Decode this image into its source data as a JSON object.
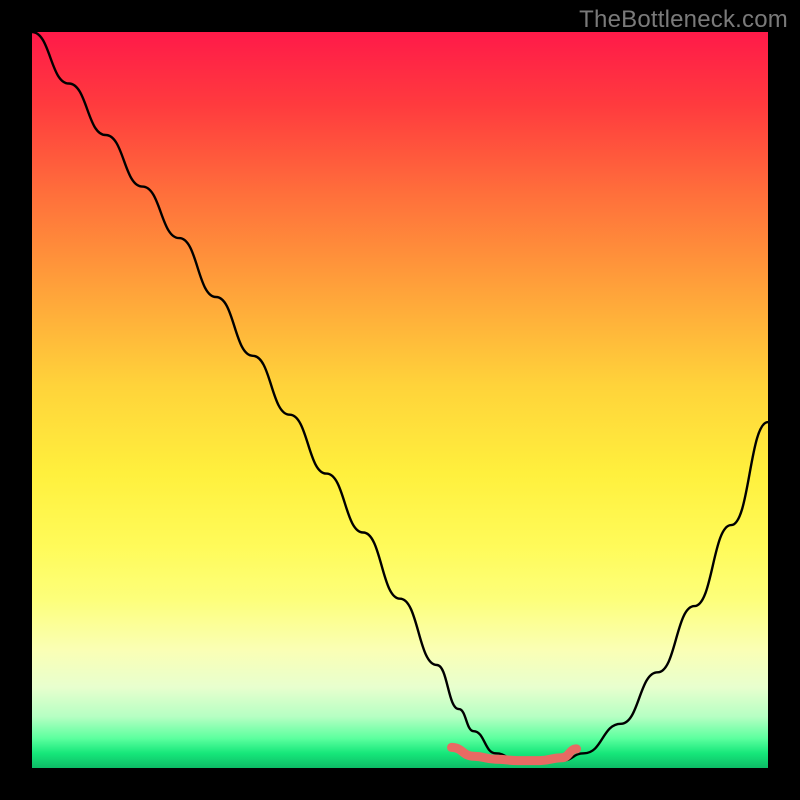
{
  "watermark": "TheBottleneck.com",
  "chart_data": {
    "type": "line",
    "title": "",
    "xlabel": "",
    "ylabel": "",
    "xlim": [
      0,
      100
    ],
    "ylim": [
      0,
      100
    ],
    "grid": false,
    "series": [
      {
        "name": "bottleneck-curve",
        "color": "#000000",
        "x": [
          0,
          5,
          10,
          15,
          20,
          25,
          30,
          35,
          40,
          45,
          50,
          55,
          58,
          60,
          63,
          66,
          69,
          72,
          75,
          80,
          85,
          90,
          95,
          100
        ],
        "y": [
          100,
          93,
          86,
          79,
          72,
          64,
          56,
          48,
          40,
          32,
          23,
          14,
          8,
          5,
          2,
          1,
          1,
          1,
          2,
          6,
          13,
          22,
          33,
          47
        ]
      },
      {
        "name": "optimal-band",
        "color": "#e86a63",
        "x": [
          57,
          60,
          63,
          66,
          69,
          72,
          74
        ],
        "y": [
          2.8,
          1.6,
          1.2,
          1.0,
          1.0,
          1.4,
          2.6
        ]
      }
    ],
    "gradient_stops": [
      {
        "pos": 0,
        "color": "#ff1a49"
      },
      {
        "pos": 10,
        "color": "#ff3b3e"
      },
      {
        "pos": 22,
        "color": "#ff6f3b"
      },
      {
        "pos": 35,
        "color": "#ffa23a"
      },
      {
        "pos": 48,
        "color": "#ffd33a"
      },
      {
        "pos": 60,
        "color": "#fff03d"
      },
      {
        "pos": 70,
        "color": "#fffb5a"
      },
      {
        "pos": 77,
        "color": "#fdff7a"
      },
      {
        "pos": 84,
        "color": "#faffb5"
      },
      {
        "pos": 89,
        "color": "#e8ffce"
      },
      {
        "pos": 93,
        "color": "#b6ffc3"
      },
      {
        "pos": 96,
        "color": "#5bff9e"
      },
      {
        "pos": 98,
        "color": "#16e77a"
      },
      {
        "pos": 100,
        "color": "#0dbb66"
      }
    ]
  }
}
